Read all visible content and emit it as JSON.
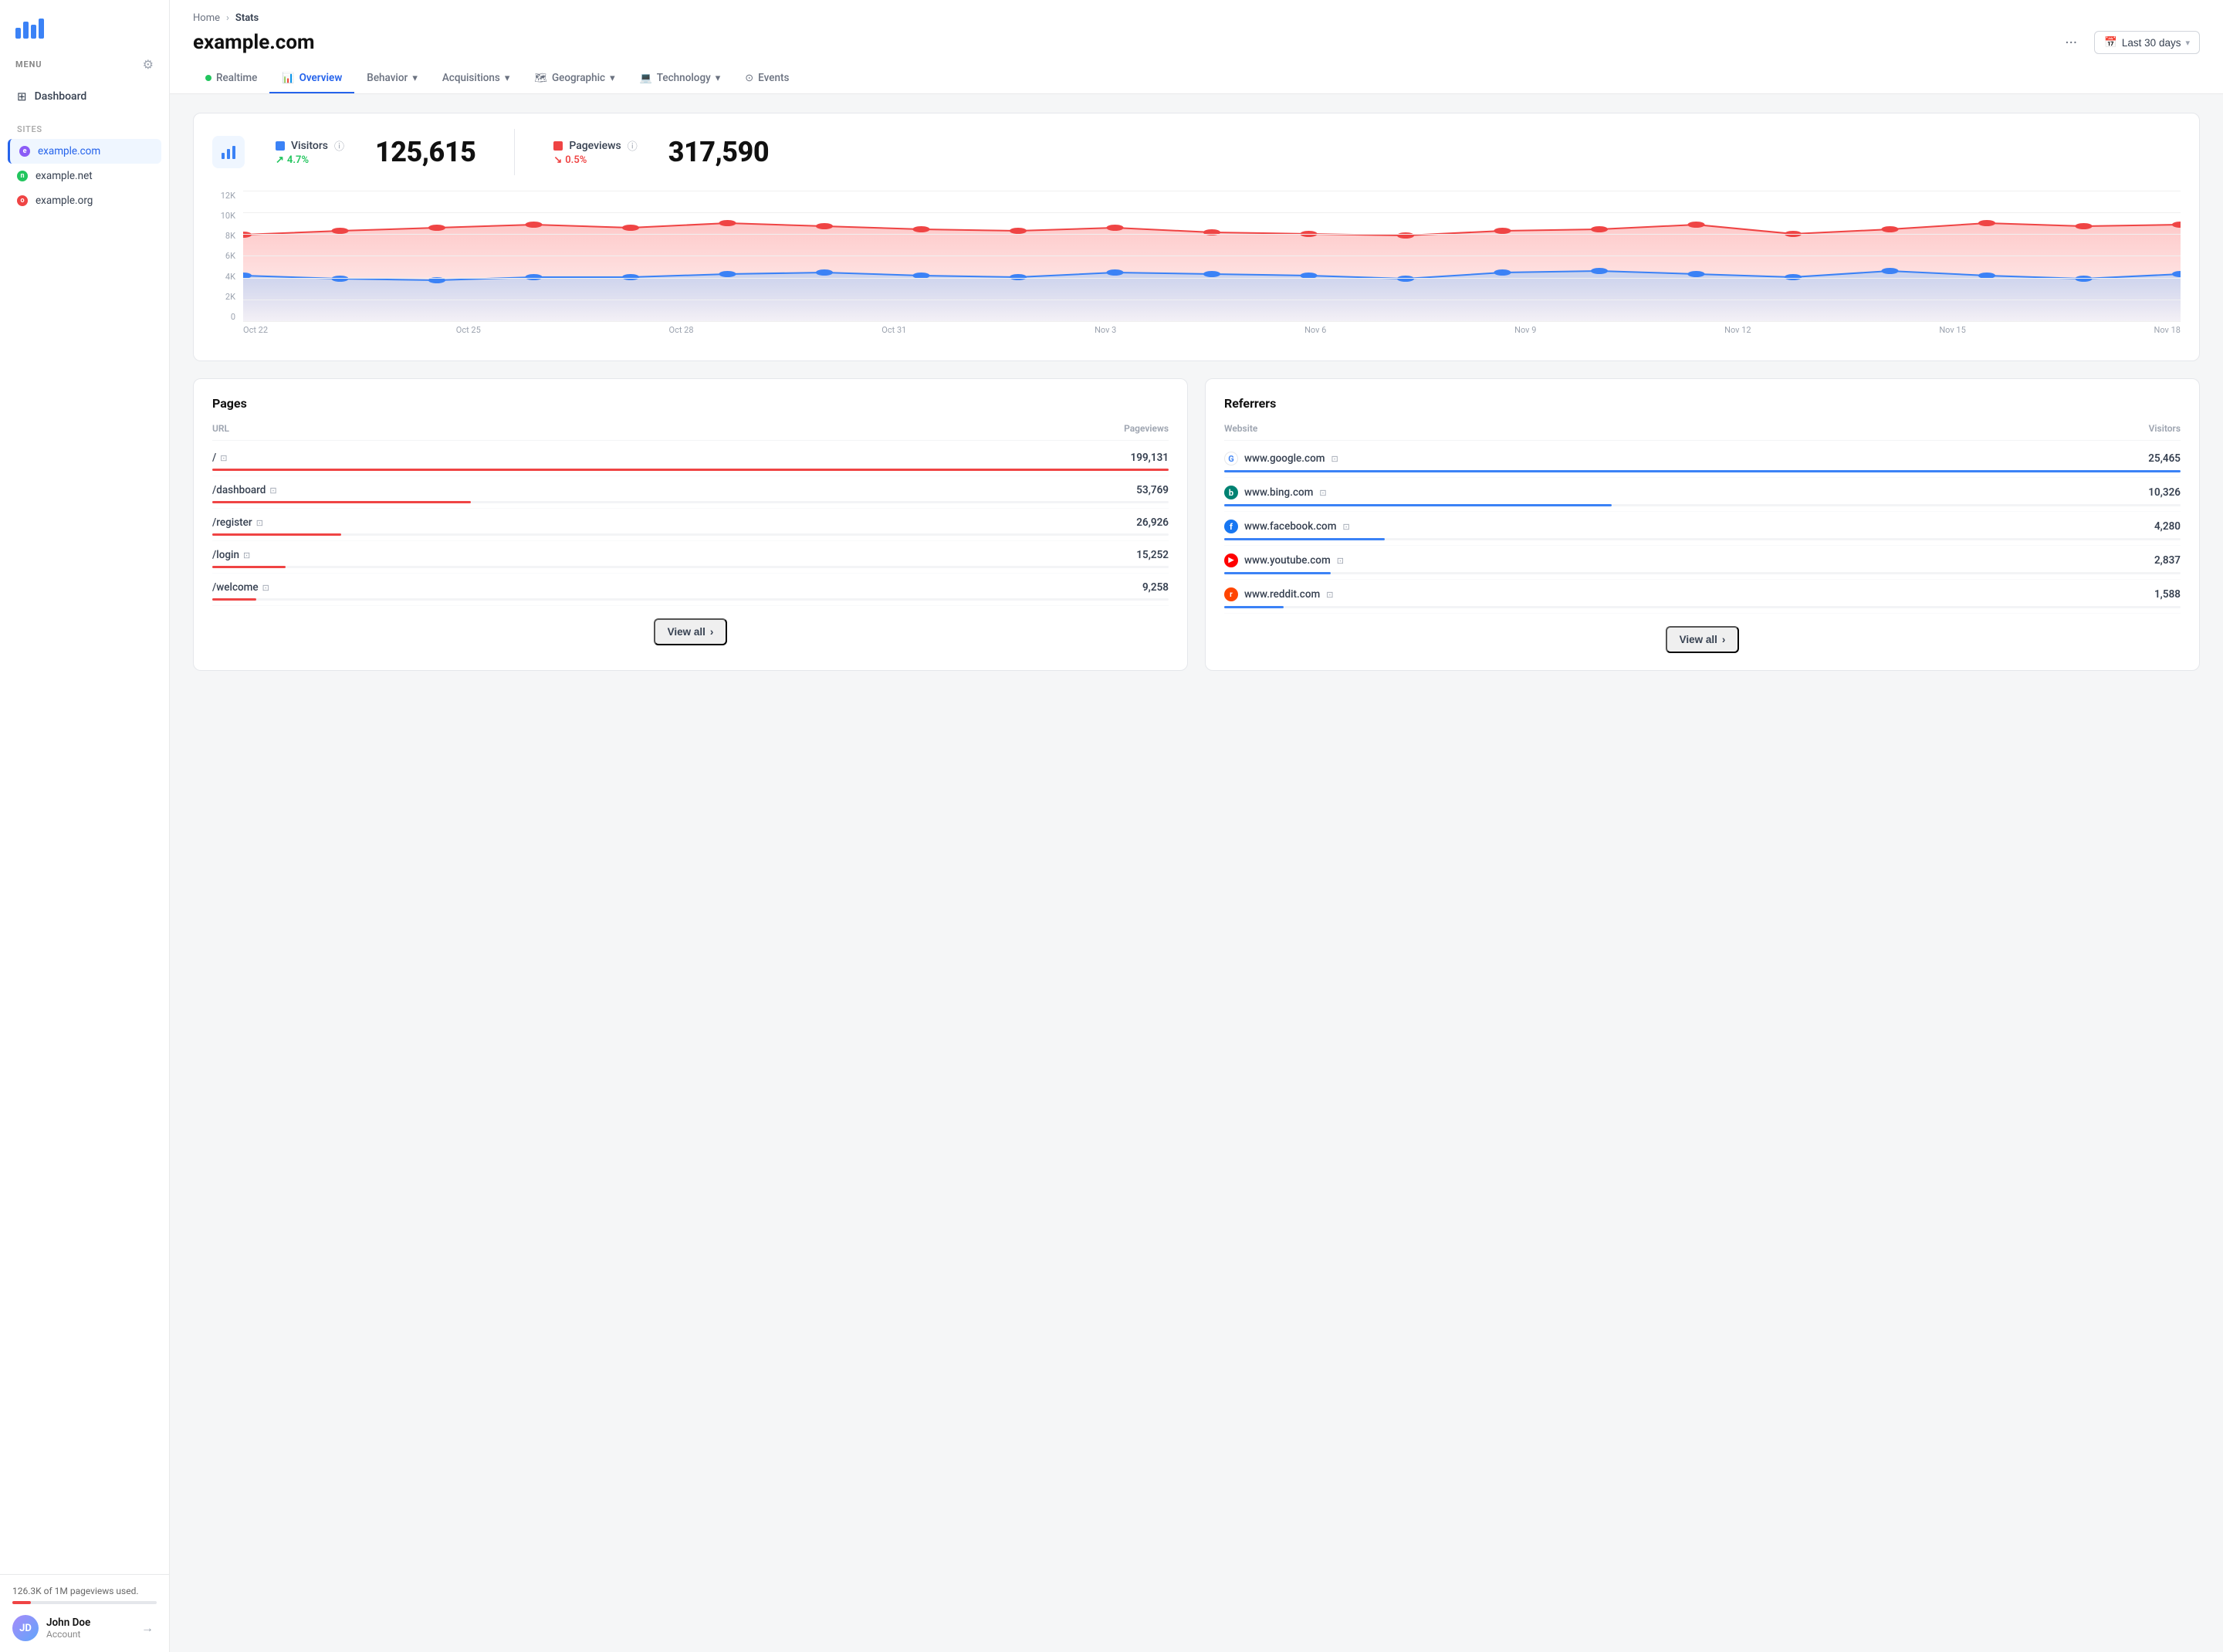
{
  "sidebar": {
    "menu_label": "MENU",
    "nav_items": [
      {
        "label": "Dashboard",
        "icon": "dashboard-icon",
        "active": false
      }
    ],
    "sites": [
      {
        "label": "example.com",
        "color": "#8b5cf6",
        "active": true,
        "letter": "e"
      },
      {
        "label": "example.net",
        "color": "#22c55e",
        "active": false,
        "letter": "n"
      },
      {
        "label": "example.org",
        "color": "#ef4444",
        "active": false,
        "letter": "o"
      }
    ],
    "usage": {
      "text": "126.3K of 1M pageviews used.",
      "percent": 12.6
    },
    "user": {
      "name": "John Doe",
      "role": "Account"
    }
  },
  "header": {
    "breadcrumb_home": "Home",
    "breadcrumb_current": "Stats",
    "title": "example.com",
    "dots_label": "···",
    "date_label": "Last 30 days",
    "tabs": [
      {
        "label": "Realtime",
        "type": "dot",
        "active": false
      },
      {
        "label": "Overview",
        "type": "chart-icon",
        "active": true
      },
      {
        "label": "Behavior",
        "type": "dropdown",
        "active": false
      },
      {
        "label": "Acquisitions",
        "type": "dropdown",
        "active": false
      },
      {
        "label": "Geographic",
        "type": "dropdown",
        "active": false
      },
      {
        "label": "Technology",
        "type": "dropdown",
        "active": false
      },
      {
        "label": "Events",
        "type": "target-icon",
        "active": false
      }
    ]
  },
  "stats": {
    "visitors_label": "Visitors",
    "visitors_change": "4.7%",
    "visitors_change_dir": "up",
    "visitors_value": "125,615",
    "pageviews_label": "Pageviews",
    "pageviews_change": "0.5%",
    "pageviews_change_dir": "down",
    "pageviews_value": "317,590"
  },
  "chart": {
    "y_labels": [
      "12K",
      "10K",
      "8K",
      "6K",
      "4K",
      "2K",
      "0"
    ],
    "x_labels": [
      "Oct 22",
      "Oct 25",
      "Oct 28",
      "Oct 31",
      "Nov 3",
      "Nov 6",
      "Nov 9",
      "Nov 12",
      "Nov 15",
      "Nov 18"
    ]
  },
  "pages": {
    "title": "Pages",
    "col_url": "URL",
    "col_views": "Pageviews",
    "rows": [
      {
        "url": "/",
        "views": "199,131",
        "bar_pct": 100
      },
      {
        "url": "/dashboard",
        "views": "53,769",
        "bar_pct": 27
      },
      {
        "url": "/register",
        "views": "26,926",
        "bar_pct": 13.5
      },
      {
        "url": "/login",
        "views": "15,252",
        "bar_pct": 7.7
      },
      {
        "url": "/welcome",
        "views": "9,258",
        "bar_pct": 4.6
      }
    ],
    "view_all": "View all"
  },
  "referrers": {
    "title": "Referrers",
    "col_website": "Website",
    "col_visitors": "Visitors",
    "rows": [
      {
        "label": "www.google.com",
        "icon_letter": "G",
        "icon_color": "#4285f4",
        "icon_bg": "#fff",
        "visitors": "25,465",
        "bar_pct": 100
      },
      {
        "label": "www.bing.com",
        "icon_letter": "b",
        "icon_color": "#008272",
        "icon_bg": "#fff",
        "visitors": "10,326",
        "bar_pct": 40.5
      },
      {
        "label": "www.facebook.com",
        "icon_letter": "f",
        "icon_color": "#fff",
        "icon_bg": "#1877f2",
        "visitors": "4,280",
        "bar_pct": 16.8
      },
      {
        "label": "www.youtube.com",
        "icon_letter": "▶",
        "icon_color": "#fff",
        "icon_bg": "#ff0000",
        "visitors": "2,837",
        "bar_pct": 11.1
      },
      {
        "label": "www.reddit.com",
        "icon_letter": "r",
        "icon_color": "#fff",
        "icon_bg": "#ff4500",
        "visitors": "1,588",
        "bar_pct": 6.2
      }
    ],
    "view_all": "View all"
  }
}
